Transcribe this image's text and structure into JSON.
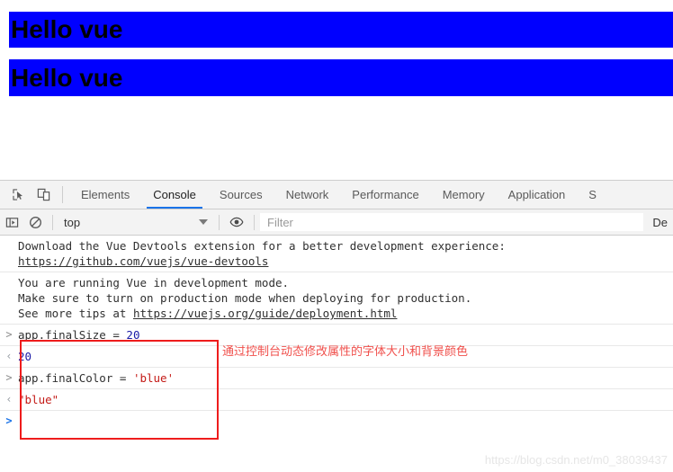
{
  "page": {
    "banners": [
      {
        "text": "Hello vue",
        "background": "#0000ff",
        "color": "#000000",
        "font_size": "28px"
      },
      {
        "text": "Hello vue",
        "background": "#0000ff",
        "color": "#000000",
        "font_size": "28px"
      }
    ]
  },
  "devtools": {
    "icons": {
      "inspect": "inspect-element-icon",
      "device": "device-toolbar-icon",
      "sidebar": "console-sidebar-icon",
      "clear": "clear-console-icon",
      "eye": "live-expression-eye-icon"
    },
    "tabs": [
      {
        "label": "Elements",
        "active": false
      },
      {
        "label": "Console",
        "active": true
      },
      {
        "label": "Sources",
        "active": false
      },
      {
        "label": "Network",
        "active": false
      },
      {
        "label": "Performance",
        "active": false
      },
      {
        "label": "Memory",
        "active": false
      },
      {
        "label": "Application",
        "active": false
      },
      {
        "label": "S",
        "active": false
      }
    ],
    "active_tab_underline_color": "#1a73e8",
    "filterbar": {
      "context": "top",
      "filter_placeholder": "Filter",
      "filter_value": "",
      "levels": "De"
    },
    "console": {
      "messages": [
        {
          "lines": [
            {
              "text": "Download the Vue Devtools extension for a better development experience:",
              "link": false
            },
            {
              "text": "https://github.com/vuejs/vue-devtools",
              "link": true
            }
          ]
        },
        {
          "lines": [
            {
              "text": "You are running Vue in development mode.",
              "link": false
            },
            {
              "text": "Make sure to turn on production mode when deploying for production.",
              "link": false
            },
            {
              "text": "See more tips at ",
              "link": false,
              "trailing_link": "https://vuejs.org/guide/deployment.html"
            }
          ]
        }
      ],
      "entries": [
        {
          "kind": "input",
          "marker": ">",
          "parts": [
            {
              "t": "app.finalSize = ",
              "c": "plain"
            },
            {
              "t": "20",
              "c": "num"
            }
          ]
        },
        {
          "kind": "output",
          "marker": "‹",
          "parts": [
            {
              "t": "20",
              "c": "num"
            }
          ]
        },
        {
          "kind": "input",
          "marker": ">",
          "parts": [
            {
              "t": "app.finalColor = ",
              "c": "plain"
            },
            {
              "t": "'blue'",
              "c": "str"
            }
          ]
        },
        {
          "kind": "output",
          "marker": "‹",
          "parts": [
            {
              "t": "\"blue\"",
              "c": "str"
            }
          ]
        },
        {
          "kind": "prompt",
          "marker": ">",
          "parts": []
        }
      ]
    }
  },
  "annotation": {
    "text": "通过控制台动态修改属性的字体大小和背景颜色",
    "box_color": "#ee1c1c",
    "text_color": "#f0504c"
  },
  "watermark": "https://blog.csdn.net/m0_38039437"
}
